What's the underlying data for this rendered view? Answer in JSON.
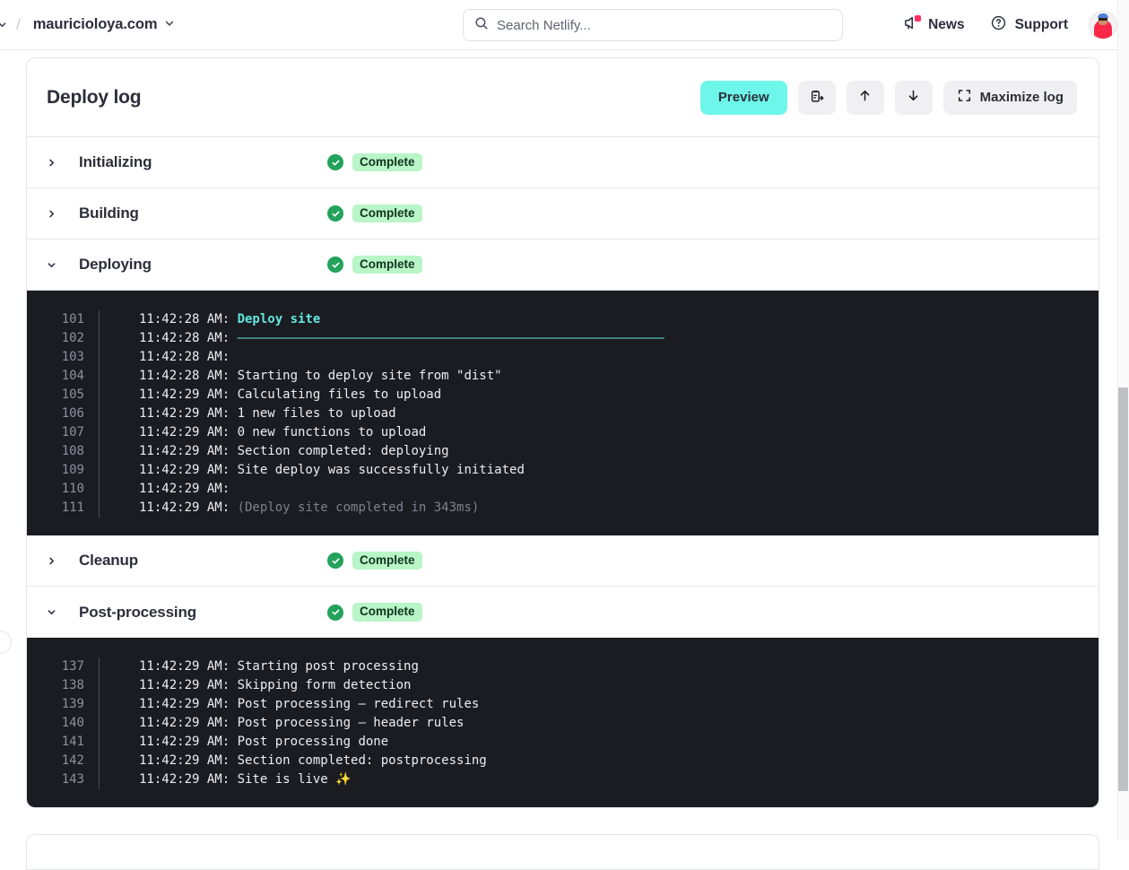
{
  "topbar": {
    "breadcrumb_separator": "/",
    "site_name": "mauricioloya.com",
    "search": {
      "placeholder": "Search Netlify...",
      "value": ""
    },
    "news_label": "News",
    "support_label": "Support",
    "avatar_name": "user-avatar"
  },
  "card": {
    "title": "Deploy log",
    "actions": {
      "preview": "Preview",
      "copy": "",
      "scroll_up": "",
      "scroll_down": "",
      "maximize": "Maximize log"
    }
  },
  "stages": [
    {
      "name": "Initializing",
      "expanded": false,
      "status": "Complete"
    },
    {
      "name": "Building",
      "expanded": false,
      "status": "Complete"
    },
    {
      "name": "Deploying",
      "expanded": true,
      "status": "Complete"
    },
    {
      "name": "Cleanup",
      "expanded": false,
      "status": "Complete"
    },
    {
      "name": "Post-processing",
      "expanded": true,
      "status": "Complete"
    }
  ],
  "deploying_log": [
    {
      "n": "101",
      "time": "11:42:28 AM: ",
      "text": "Deploy site",
      "style": "accent"
    },
    {
      "n": "102",
      "time": "11:42:28 AM: ",
      "text": "————————————————————————————————————————————————————————————",
      "style": "rule"
    },
    {
      "n": "103",
      "time": "11:42:28 AM: ",
      "text": "",
      "style": "plain"
    },
    {
      "n": "104",
      "time": "11:42:28 AM: ",
      "text": "Starting to deploy site from \"dist\"",
      "style": "plain"
    },
    {
      "n": "105",
      "time": "11:42:29 AM: ",
      "text": "Calculating files to upload",
      "style": "plain"
    },
    {
      "n": "106",
      "time": "11:42:29 AM: ",
      "text": "1 new files to upload",
      "style": "plain"
    },
    {
      "n": "107",
      "time": "11:42:29 AM: ",
      "text": "0 new functions to upload",
      "style": "plain"
    },
    {
      "n": "108",
      "time": "11:42:29 AM: ",
      "text": "Section completed: deploying",
      "style": "plain"
    },
    {
      "n": "109",
      "time": "11:42:29 AM: ",
      "text": "Site deploy was successfully initiated",
      "style": "plain"
    },
    {
      "n": "110",
      "time": "11:42:29 AM: ",
      "text": "",
      "style": "plain"
    },
    {
      "n": "111",
      "time": "11:42:29 AM: ",
      "text": "(Deploy site completed in 343ms)",
      "style": "dim"
    }
  ],
  "postprocessing_log": [
    {
      "n": "137",
      "time": "11:42:29 AM: ",
      "text": "Starting post processing",
      "style": "plain"
    },
    {
      "n": "138",
      "time": "11:42:29 AM: ",
      "text": "Skipping form detection",
      "style": "plain"
    },
    {
      "n": "139",
      "time": "11:42:29 AM: ",
      "text": "Post processing — redirect rules",
      "style": "plain"
    },
    {
      "n": "140",
      "time": "11:42:29 AM: ",
      "text": "Post processing — header rules",
      "style": "plain"
    },
    {
      "n": "141",
      "time": "11:42:29 AM: ",
      "text": "Post processing done",
      "style": "plain"
    },
    {
      "n": "142",
      "time": "11:42:29 AM: ",
      "text": "Section completed: postprocessing",
      "style": "plain"
    },
    {
      "n": "143",
      "time": "11:42:29 AM: ",
      "text": "Site is live ✨",
      "style": "plain"
    }
  ],
  "colors": {
    "preview_button": "#6ff6ea",
    "log_background": "#1b1c22",
    "log_accent": "#63e8de",
    "status_badge_bg": "#b8f5c7",
    "status_check": "#22a25a",
    "news_badge": "#ff2e63"
  }
}
